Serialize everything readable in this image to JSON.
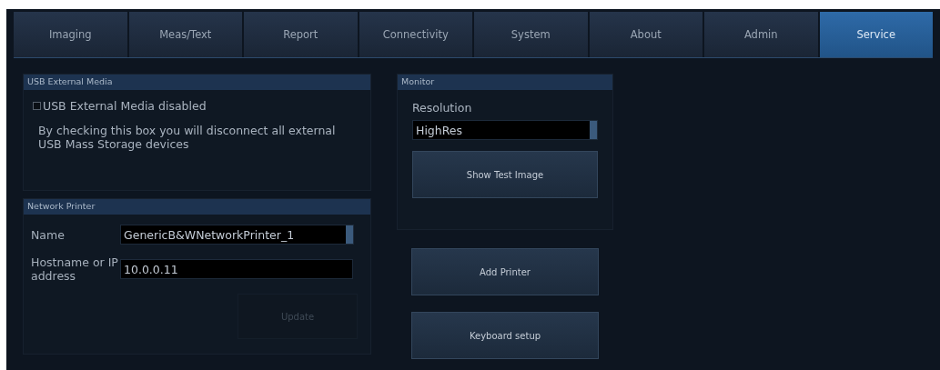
{
  "tabs": [
    {
      "label": "Imaging",
      "selected": false
    },
    {
      "label": "Meas/Text",
      "selected": false
    },
    {
      "label": "Report",
      "selected": false
    },
    {
      "label": "Connectivity",
      "selected": false
    },
    {
      "label": "System",
      "selected": false
    },
    {
      "label": "About",
      "selected": false
    },
    {
      "label": "Admin",
      "selected": false
    },
    {
      "label": "Service",
      "selected": true
    }
  ],
  "usb": {
    "title": "USB External Media",
    "checkbox": {
      "label": "USB External Media disabled",
      "checked": false
    },
    "note": "By checking this box you will disconnect all external USB Mass Storage devices"
  },
  "network_printer": {
    "title": "Network Printer",
    "name_label": "Name",
    "name_value": "GenericB&WNetworkPrinter_1",
    "host_label": "Hostname or IP address",
    "host_value": "10.0.0.11",
    "update_button": {
      "label": "Update",
      "disabled": true
    }
  },
  "monitor": {
    "title": "Monitor",
    "resolution_label": "Resolution",
    "resolution_value": "HighRes",
    "test_button": "Show Test Image"
  },
  "buttons": [
    "Add Printer",
    "Keyboard setup"
  ]
}
